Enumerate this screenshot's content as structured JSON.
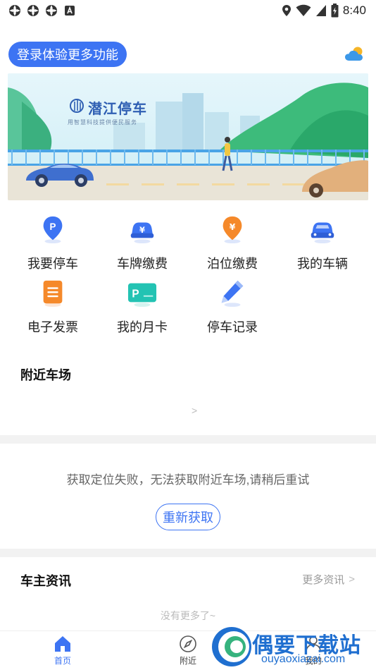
{
  "status_bar": {
    "time": "8:40",
    "icons": [
      "app-notification-icon",
      "app-notification-icon",
      "app-notification-icon",
      "font-a-icon",
      "location-icon",
      "wifi-icon",
      "signal-icon",
      "battery-icon"
    ]
  },
  "header": {
    "login_label": "登录体验更多功能",
    "weather_icon": "cloud-sun-icon"
  },
  "banner": {
    "title": "潜江停车",
    "subtitle": "用智慧科技提供便民服务"
  },
  "menu": [
    {
      "label": "我要停车",
      "icon": "parking-pin-icon"
    },
    {
      "label": "车牌缴费",
      "icon": "car-yuan-icon"
    },
    {
      "label": "泊位缴费",
      "icon": "yuan-pin-icon"
    },
    {
      "label": "我的车辆",
      "icon": "car-icon"
    },
    {
      "label": "电子发票",
      "icon": "invoice-icon"
    },
    {
      "label": "我的月卡",
      "icon": "parking-card-icon"
    },
    {
      "label": "停车记录",
      "icon": "pencil-record-icon"
    }
  ],
  "nearby": {
    "title": "附近车场",
    "chevron": ">",
    "error_text": "获取定位失败，无法获取附近车场,请稍后重试",
    "retry_label": "重新获取"
  },
  "news": {
    "title": "车主资讯",
    "more_label": "更多资讯",
    "more_chevron": ">",
    "empty_text": "没有更多了~"
  },
  "bottom_nav": [
    {
      "label": "首页",
      "icon": "home-icon",
      "active": true
    },
    {
      "label": "附近",
      "icon": "compass-icon",
      "active": false
    },
    {
      "label": "我的",
      "icon": "person-icon",
      "active": false
    }
  ],
  "watermark": {
    "text": "偶要下载站",
    "url": "ouyaoxiazai.com"
  },
  "colors": {
    "accent": "#3d74f3",
    "divider": "#f2f2f2",
    "text_muted": "#999999"
  }
}
